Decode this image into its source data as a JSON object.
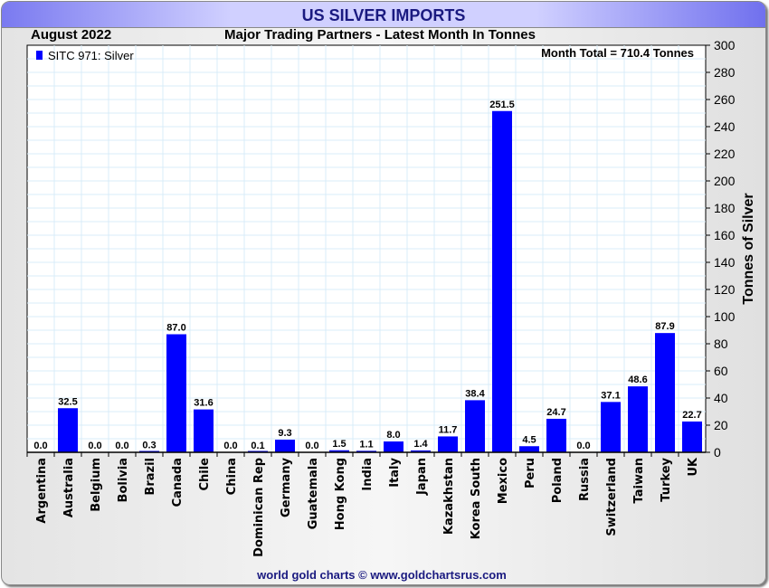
{
  "header": {
    "title": "US SILVER IMPORTS",
    "date": "August 2022",
    "subtitle": "Major Trading Partners - Latest Month In Tonnes"
  },
  "footer": "world gold charts © www.goldchartsrus.com",
  "colors": {
    "bar": "#0000ff",
    "grid": "#d8ecf8"
  },
  "chart_data": {
    "type": "bar",
    "title": "Major Trading Partners - Latest Month In Tonnes",
    "ylabel": "Tonnes of Silver",
    "xlabel": "",
    "ylim": [
      0,
      300
    ],
    "yticks": [
      0,
      20,
      40,
      60,
      80,
      100,
      120,
      140,
      160,
      180,
      200,
      220,
      240,
      260,
      280,
      300
    ],
    "legend": {
      "label": "SITC 971: Silver",
      "position": "top-left"
    },
    "annotation": "Month Total = 710.4 Tonnes",
    "grid": true,
    "categories": [
      "Argentina",
      "Australia",
      "Belgium",
      "Bolivia",
      "Brazil",
      "Canada",
      "Chile",
      "China",
      "Dominican Rep",
      "Germany",
      "Guatemala",
      "Hong Kong",
      "India",
      "Italy",
      "Japan",
      "Kazakhstan",
      "Korea South",
      "Mexico",
      "Peru",
      "Poland",
      "Russia",
      "Switzerland",
      "Taiwan",
      "Turkey",
      "UK"
    ],
    "values": [
      0.0,
      32.5,
      0.0,
      0.0,
      0.3,
      87.0,
      31.6,
      0.0,
      0.1,
      9.3,
      0.0,
      1.5,
      1.1,
      8.0,
      1.4,
      11.7,
      38.4,
      251.5,
      4.5,
      24.7,
      0.0,
      37.1,
      48.6,
      87.9,
      22.7
    ]
  }
}
